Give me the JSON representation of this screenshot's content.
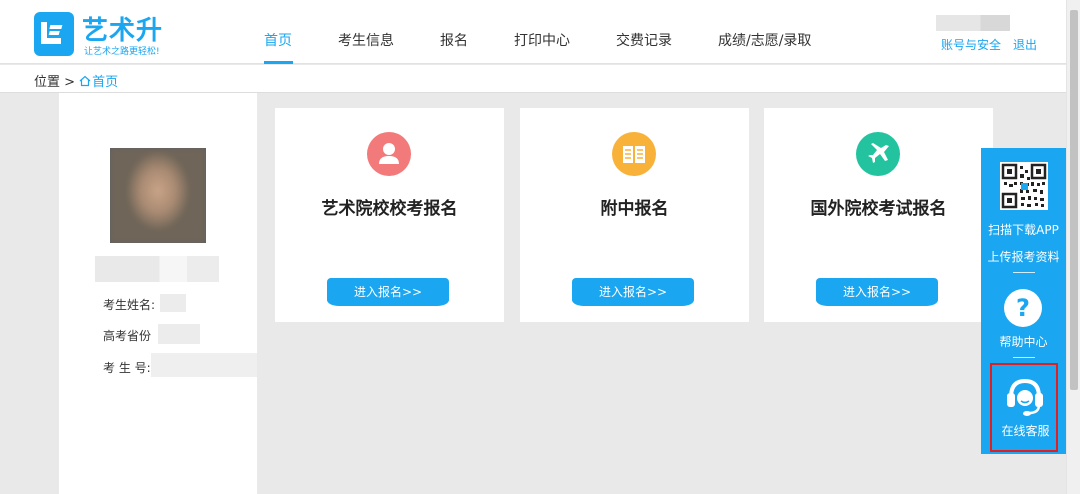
{
  "brand": {
    "name": "艺术升",
    "slogan": "让艺术之路更轻松!",
    "color": "#1aa6f0"
  },
  "nav": {
    "items": [
      {
        "label": "首页",
        "active": true
      },
      {
        "label": "考生信息"
      },
      {
        "label": "报名"
      },
      {
        "label": "打印中心"
      },
      {
        "label": "交费记录"
      },
      {
        "label": "成绩/志愿/录取"
      }
    ]
  },
  "account": {
    "security_label": "账号与安全",
    "logout_label": "退出"
  },
  "breadcrumb": {
    "prefix": "位置 >",
    "home_label": "首页"
  },
  "profile": {
    "name_label": "考生姓名:",
    "province_label": "高考省份",
    "id_label": "考 生 号:"
  },
  "cards": [
    {
      "title": "艺术院校校考报名",
      "button": "进入报名>>",
      "icon": "person-icon",
      "color": "#f27a7a"
    },
    {
      "title": "附中报名",
      "button": "进入报名>>",
      "icon": "book-icon",
      "color": "#f8b23a"
    },
    {
      "title": "国外院校考试报名",
      "button": "进入报名>>",
      "icon": "plane-icon",
      "color": "#23c3a0"
    }
  ],
  "float_panel": {
    "scan_label": "扫描下载APP",
    "upload_label": "上传报考资料",
    "help_label": "帮助中心",
    "help_glyph": "?",
    "service_label": "在线客服",
    "highlight_color": "#e02020"
  }
}
